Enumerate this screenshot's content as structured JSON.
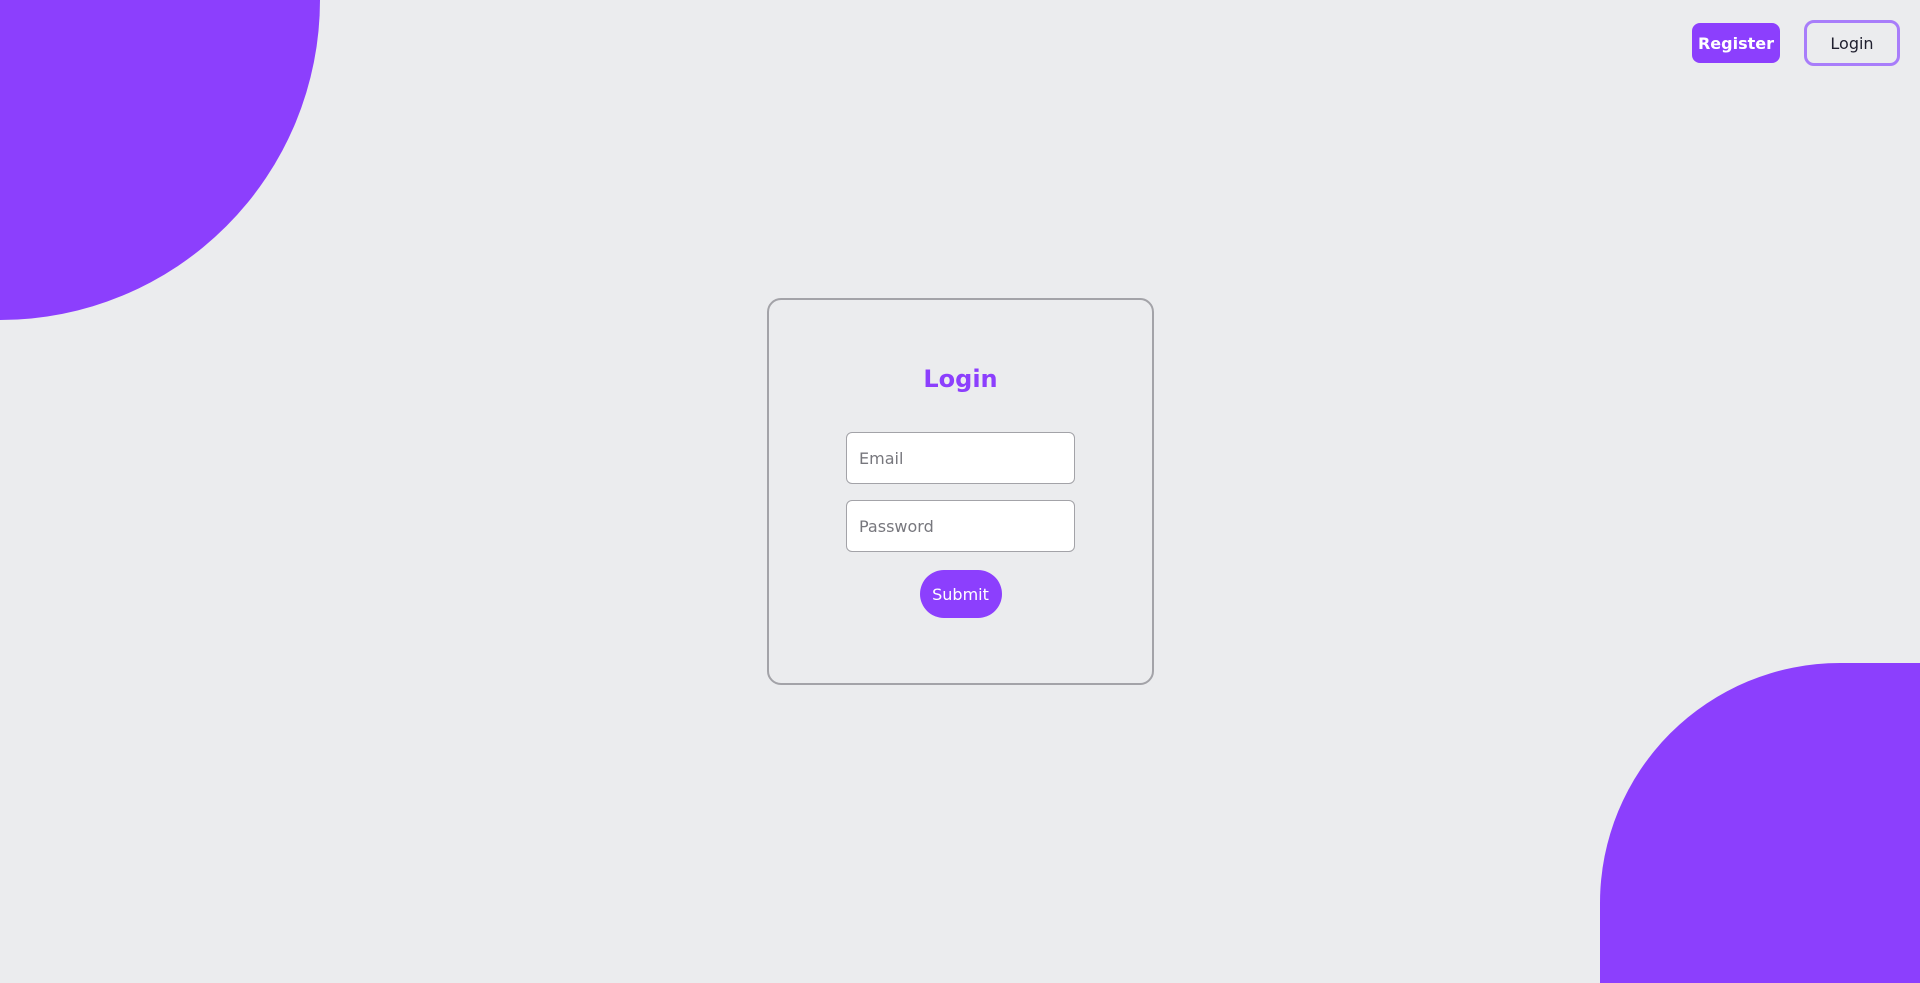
{
  "header": {
    "register_label": "Register",
    "login_label": "Login"
  },
  "login_form": {
    "title": "Login",
    "email_placeholder": "Email",
    "password_placeholder": "Password",
    "submit_label": "Submit"
  },
  "colors": {
    "accent": "#8c3ffd",
    "background": "#ebecee",
    "login_outline": "#a87dfa",
    "border": "#a3a3a8"
  }
}
